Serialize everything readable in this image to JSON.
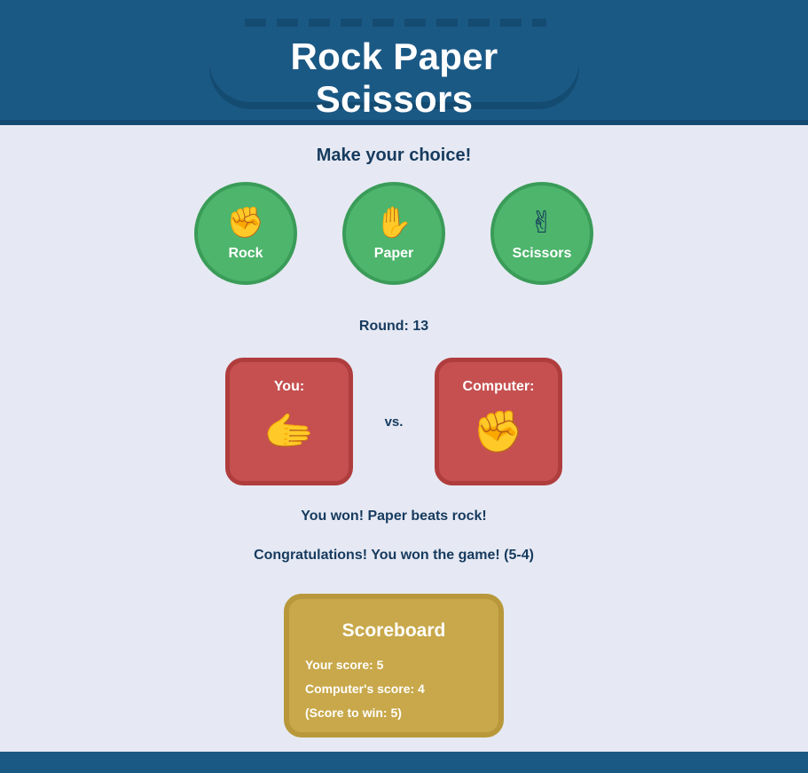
{
  "header": {
    "title": "Rock Paper Scissors"
  },
  "prompt": "Make your choice!",
  "choices": [
    {
      "icon": "✊",
      "icon_name": "rock-fist-icon",
      "label": "Rock"
    },
    {
      "icon": "✋",
      "icon_name": "paper-hand-icon",
      "label": "Paper"
    },
    {
      "icon": "✌",
      "icon_name": "scissors-hand-icon",
      "label": "Scissors"
    }
  ],
  "round": "Round: 13",
  "player": {
    "label": "You:",
    "icon": "🫱",
    "icon_name": "paper-hand-icon"
  },
  "vs": "vs.",
  "computer": {
    "label": "Computer:",
    "icon": "✊",
    "icon_name": "rock-fist-icon"
  },
  "result_message": "You won! Paper beats rock!",
  "game_message": "Congratulations! You won the game! (5-4)",
  "scoreboard": {
    "title": "Scoreboard",
    "your_score": "Your score: 5",
    "computer_score": "Computer's score: 4",
    "score_to_win": "(Score to win: 5)"
  },
  "colors": {
    "header": "#1b5985",
    "background": "#e6e9f3",
    "choice_button": "#4db56c",
    "result_card": "#c65050",
    "scoreboard": "#c8a84a",
    "text": "#163a5e"
  }
}
